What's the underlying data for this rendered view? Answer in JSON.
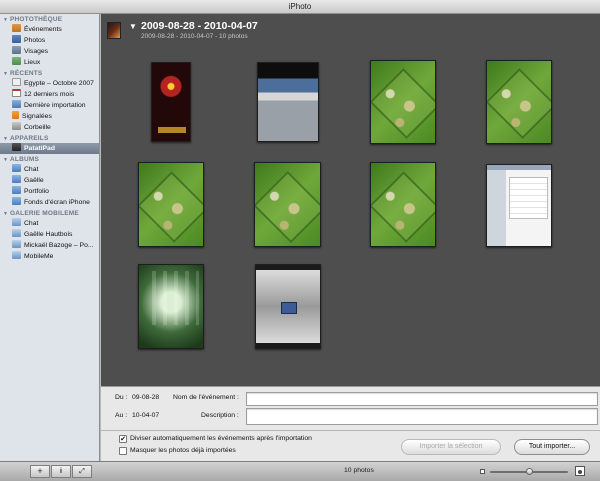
{
  "window": {
    "title": "iPhoto"
  },
  "sidebar": {
    "sections": [
      {
        "header": "PHOTOTHÈQUE",
        "items": [
          {
            "label": "Événements",
            "icon": "events-icon",
            "icon_class": "ico-events",
            "selected": false
          },
          {
            "label": "Photos",
            "icon": "photos-icon",
            "icon_class": "ico-photos",
            "selected": false
          },
          {
            "label": "Visages",
            "icon": "faces-icon",
            "icon_class": "ico-faces",
            "selected": false
          },
          {
            "label": "Lieux",
            "icon": "places-icon",
            "icon_class": "ico-places",
            "selected": false
          }
        ]
      },
      {
        "header": "RÉCENTS",
        "items": [
          {
            "label": "Egypte – Octobre 2007",
            "icon": "event-icon",
            "icon_class": "ico-recent",
            "selected": false
          },
          {
            "label": "12 derniers mois",
            "icon": "calendar-icon",
            "icon_class": "ico-cal",
            "selected": false
          },
          {
            "label": "Dernière importation",
            "icon": "import-icon",
            "icon_class": "ico-import",
            "selected": false
          },
          {
            "label": "Signalées",
            "icon": "flag-icon",
            "icon_class": "ico-flag",
            "selected": false
          },
          {
            "label": "Corbeille",
            "icon": "trash-icon",
            "icon_class": "ico-trash",
            "selected": false
          }
        ]
      },
      {
        "header": "APPAREILS",
        "items": [
          {
            "label": "PatatiPad",
            "icon": "device-icon",
            "icon_class": "ico-device",
            "selected": true
          }
        ]
      },
      {
        "header": "ALBUMS",
        "items": [
          {
            "label": "Chat",
            "icon": "album-icon",
            "icon_class": "ico-album",
            "selected": false
          },
          {
            "label": "Gaëlle",
            "icon": "album-icon",
            "icon_class": "ico-album",
            "selected": false
          },
          {
            "label": "Portfolio",
            "icon": "album-icon",
            "icon_class": "ico-album",
            "selected": false
          },
          {
            "label": "Fonds d'écran iPhone",
            "icon": "album-icon",
            "icon_class": "ico-album",
            "selected": false
          }
        ]
      },
      {
        "header": "GALERIE MOBILEME",
        "items": [
          {
            "label": "Chat",
            "icon": "mobileme-gallery-icon",
            "icon_class": "ico-mm",
            "selected": false
          },
          {
            "label": "Gaëlle Hautbois",
            "icon": "mobileme-gallery-icon",
            "icon_class": "ico-mm",
            "selected": false
          },
          {
            "label": "Mickaël Bazoge – Po...",
            "icon": "mobileme-gallery-icon",
            "icon_class": "ico-mm",
            "selected": false
          },
          {
            "label": "MobileMe",
            "icon": "mobileme-icon",
            "icon_class": "ico-mm",
            "selected": false
          }
        ]
      }
    ]
  },
  "event": {
    "title": "2009-08-28 - 2010-04-07",
    "subtitle": "2009-08-28 - 2010-04-07 - 10 photos"
  },
  "photos": [
    {
      "kind": "iron-man-poster"
    },
    {
      "kind": "keyboard-screen"
    },
    {
      "kind": "game-map"
    },
    {
      "kind": "game-map"
    },
    {
      "kind": "game-map"
    },
    {
      "kind": "game-map"
    },
    {
      "kind": "game-map"
    },
    {
      "kind": "settings-screen"
    },
    {
      "kind": "home-screen"
    },
    {
      "kind": "lock-screen"
    }
  ],
  "info": {
    "from_label": "Du :",
    "from_value": "09-08-28",
    "to_label": "Au :",
    "to_value": "10-04-07",
    "event_name_label": "Nom de l'événement :",
    "event_name_value": "",
    "description_label": "Description :",
    "description_value": ""
  },
  "import": {
    "split_events_label": "Diviser automatiquement les événements après l'importation",
    "split_events_checked": true,
    "hide_imported_label": "Masquer les photos déjà importées",
    "hide_imported_checked": false,
    "import_selection_label": "Importer la sélection",
    "import_all_label": "Tout importer..."
  },
  "footer": {
    "add_symbol": "+",
    "info_symbol": "i",
    "fullscreen_symbol": "⤢",
    "photo_count": "10 photos",
    "zoom_level": 0.5
  }
}
